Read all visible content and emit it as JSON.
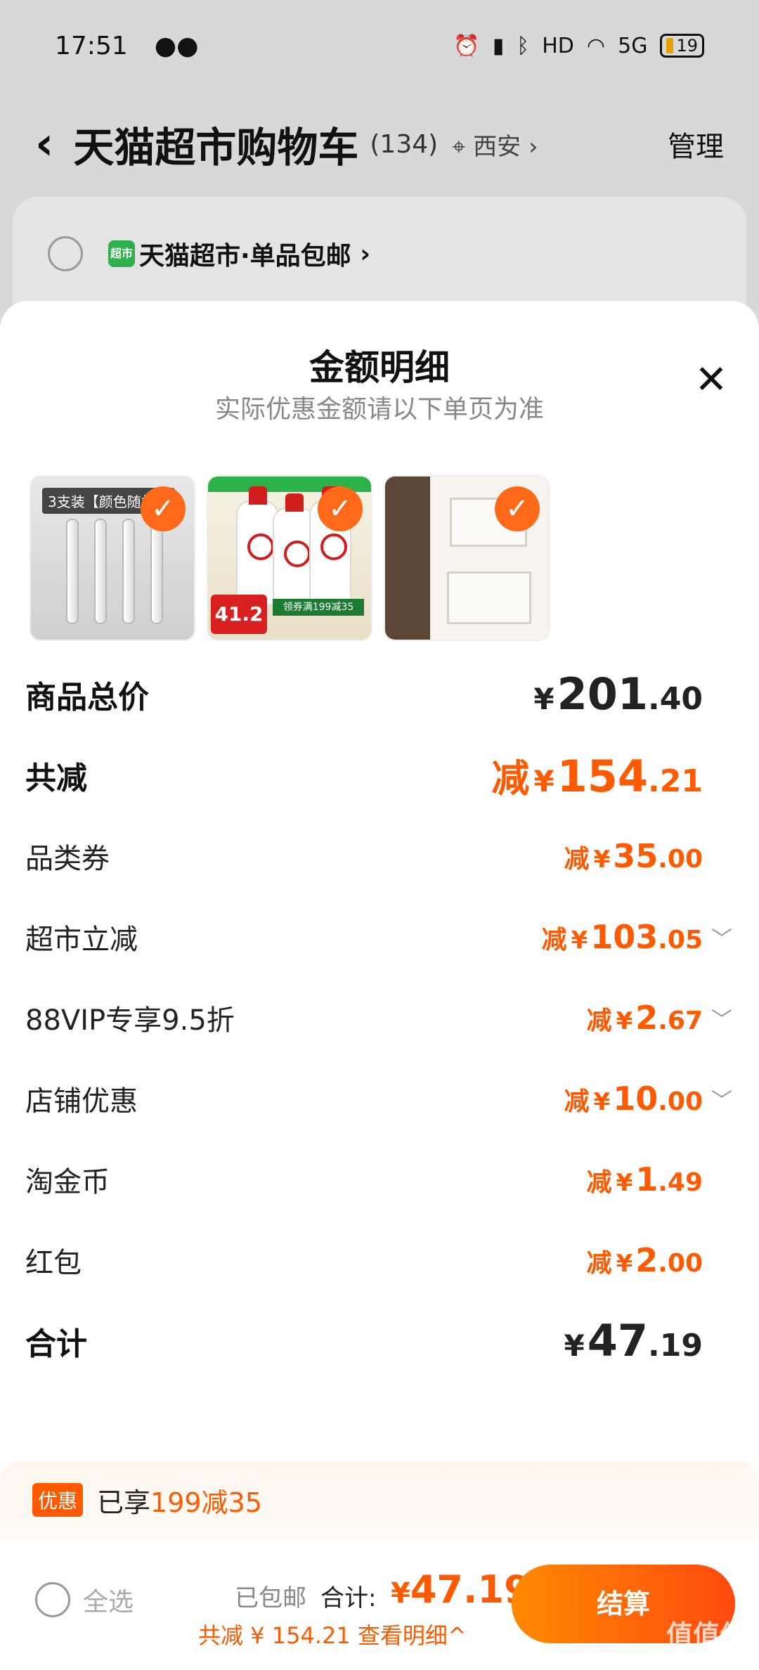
{
  "status_bar": {
    "time": "17:51",
    "network": "5G",
    "hd": "HD",
    "battery": "19"
  },
  "nav": {
    "title": "天猫超市购物车",
    "count": "(134)",
    "location": "西安",
    "manage": "管理"
  },
  "bg_card": {
    "store": "天猫超市·单品包邮",
    "badge": "超市"
  },
  "sheet": {
    "title": "金额明细",
    "subtitle": "实际优惠金额请以下单页为准",
    "thumbs": {
      "pens": {
        "tag": "3支装【颜色随机】"
      },
      "lotion": {
        "price": "41.2",
        "coupon": "领券满199减35"
      }
    },
    "rows": [
      {
        "label": "商品总价",
        "prefix": "",
        "yen": "¥",
        "int": "201",
        "dec": ".40"
      },
      {
        "label": "共减",
        "prefix": "减",
        "yen": "¥",
        "int": "154",
        "dec": ".21"
      },
      {
        "label": "品类券",
        "prefix": "减",
        "yen": "¥",
        "int": "35",
        "dec": ".00"
      },
      {
        "label": "超市立减",
        "prefix": "减",
        "yen": "¥",
        "int": "103",
        "dec": ".05"
      },
      {
        "label": "88VIP专享9.5折",
        "prefix": "减",
        "yen": "¥",
        "int": "2",
        "dec": ".67"
      },
      {
        "label": "店铺优惠",
        "prefix": "减",
        "yen": "¥",
        "int": "10",
        "dec": ".00"
      },
      {
        "label": "淘金币",
        "prefix": "减",
        "yen": "¥",
        "int": "1",
        "dec": ".49"
      },
      {
        "label": "红包",
        "prefix": "减",
        "yen": "¥",
        "int": "2",
        "dec": ".00"
      },
      {
        "label": "合计",
        "prefix": "",
        "yen": "¥",
        "int": "47",
        "dec": ".19"
      }
    ]
  },
  "promo": {
    "badge": "优惠",
    "text": "已享",
    "highlight": "199减35"
  },
  "bottom": {
    "select_all": "全选",
    "free_shipping": "已包邮",
    "total_label": "合计:",
    "total_yen": "¥",
    "total_value": "47.19",
    "saving": "共减 ¥ 154.21  查看明细^",
    "checkout": "结算"
  },
  "watermark": "值值值",
  "colors": {
    "accent": "#ff5a00",
    "checkout_start": "#ff8a00",
    "checkout_end": "#ff4a0f"
  }
}
